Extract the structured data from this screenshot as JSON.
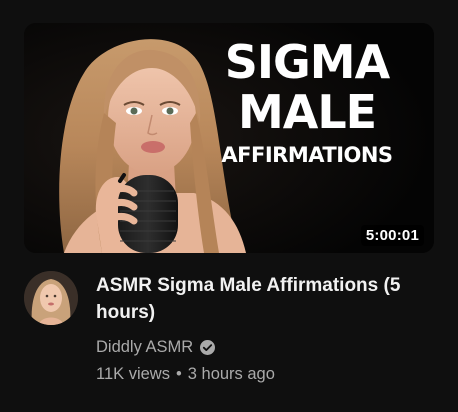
{
  "thumbnail": {
    "line1": "SIGMA",
    "line2": "MALE",
    "line3": "AFFIRMATIONS",
    "duration": "5:00:01"
  },
  "video": {
    "title": "ASMR Sigma Male Affirmations (5 hours)",
    "channel": "Diddly ASMR",
    "verified": true,
    "views": "11K views",
    "separator": "•",
    "age": "3 hours ago"
  },
  "colors": {
    "background": "#0f0f0f",
    "title": "#f1f1f1",
    "secondary_text": "#aaaaaa",
    "thumbnail_bg": "#050505"
  },
  "icons": {
    "verified": "verified-check-icon"
  }
}
